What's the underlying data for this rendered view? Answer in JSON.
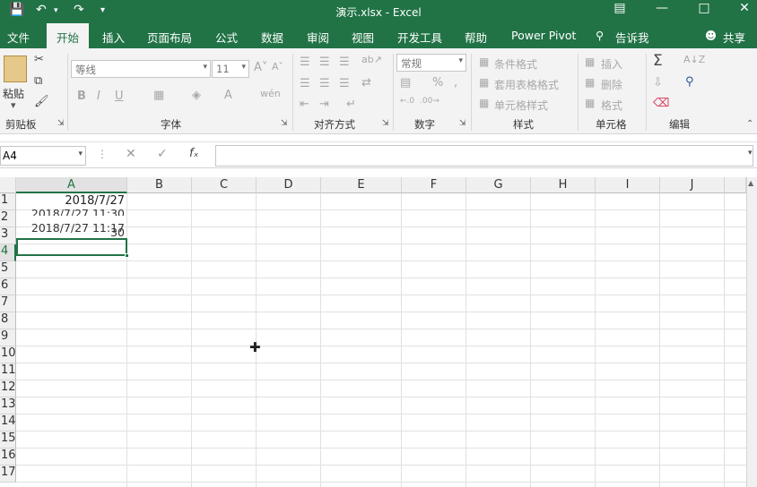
{
  "window": {
    "title": "演示.xlsx  -  Excel",
    "save_icon": "save-icon",
    "undo_icon": "undo-icon",
    "redo_icon": "redo-icon"
  },
  "tabs": [
    "文件",
    "开始",
    "插入",
    "页面布局",
    "公式",
    "数据",
    "审阅",
    "视图",
    "开发工具",
    "帮助",
    "Power Pivot"
  ],
  "tellme": "告诉我",
  "share": "共享",
  "ribbon": {
    "clipboard": {
      "label": "剪贴板",
      "paste": "粘贴"
    },
    "font": {
      "label": "字体",
      "name": "等线",
      "size": "11",
      "bold": "B",
      "italic": "I",
      "underline": "U"
    },
    "alignment": {
      "label": "对齐方式"
    },
    "number": {
      "label": "数字",
      "format": "常规"
    },
    "styles": {
      "label": "样式",
      "conditional": "条件格式",
      "table": "套用表格格式",
      "cell": "单元格样式"
    },
    "cells": {
      "label": "单元格",
      "insert": "插入",
      "delete": "删除",
      "format": "格式"
    },
    "editing": {
      "label": "编辑"
    }
  },
  "formula_bar": {
    "name_box": "A4",
    "formula": ""
  },
  "columns": [
    "A",
    "B",
    "C",
    "D",
    "E",
    "F",
    "G",
    "H",
    "I",
    "J"
  ],
  "rows": [
    "1",
    "2",
    "3",
    "4",
    "5",
    "6",
    "7",
    "8",
    "9",
    "10",
    "11",
    "12",
    "13",
    "14",
    "15",
    "16",
    "17"
  ],
  "cells": {
    "A1": "2018/7/27",
    "A2": "2018/7/27 11:30",
    "A3": "30",
    "A2b": "2018/7/27 11:17"
  },
  "accent_color": "#217346"
}
